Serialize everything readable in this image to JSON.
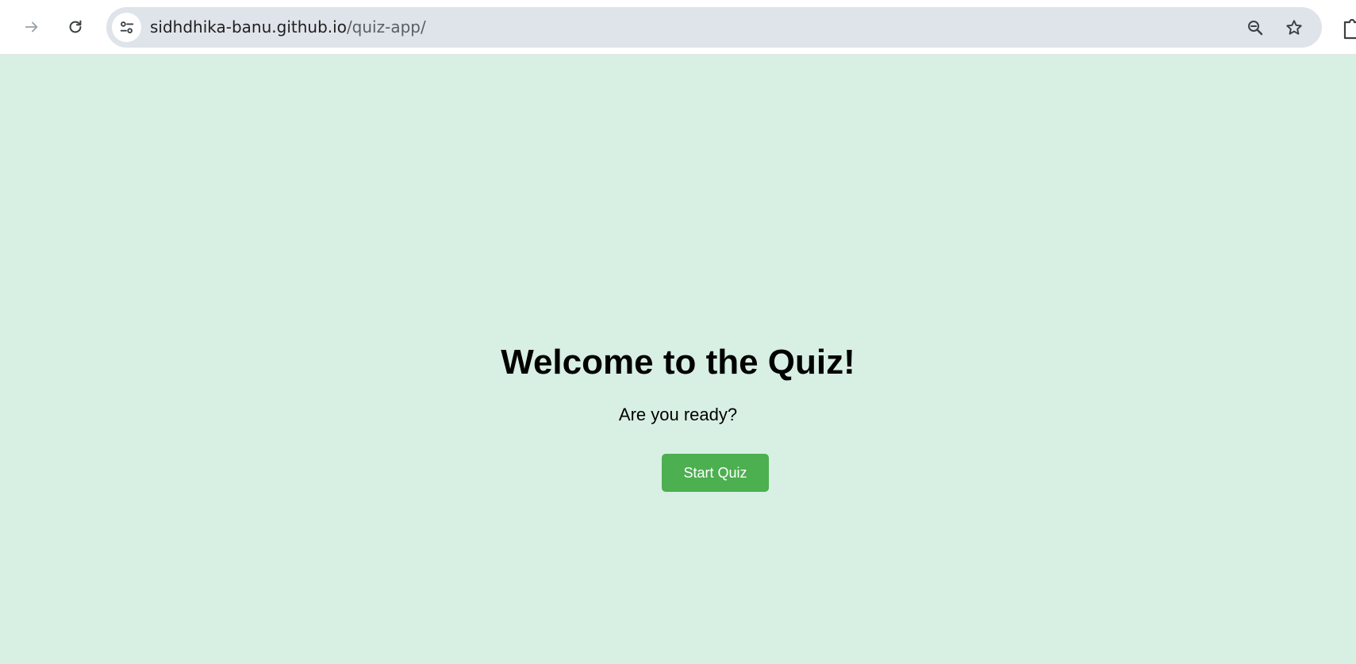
{
  "browser": {
    "url_host": "sidhdhika-banu.github.io",
    "url_path": "/quiz-app/",
    "icons": {
      "forward": "arrow-forward-icon",
      "reload": "reload-icon",
      "site_info": "tune-icon",
      "zoom": "zoom-out-icon",
      "bookmark": "star-icon",
      "extensions": "puzzle-icon"
    }
  },
  "page": {
    "background": "#d8efe3",
    "heading": "Welcome to the Quiz!",
    "subtitle": "Are you ready?",
    "start_button_label": "Start Quiz",
    "button_color": "#4caf50"
  }
}
